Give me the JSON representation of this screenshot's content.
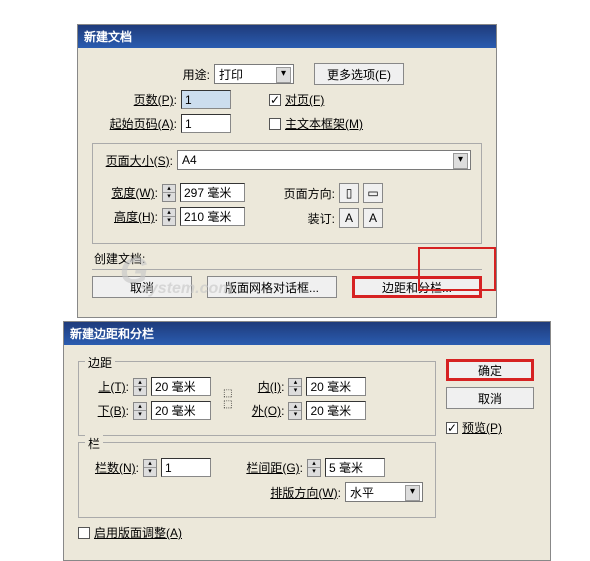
{
  "dialog1": {
    "title": "新建文档",
    "use_label": "用途:",
    "use_value": "打印",
    "more_options_btn": "更多选项(E)",
    "pages_label": "页数(P):",
    "pages_value": "1",
    "facing_label": "对页(F)",
    "start_page_label": "起始页码(A):",
    "start_page_value": "1",
    "master_frame_label": "主文本框架(M)",
    "page_size_label": "页面大小(S):",
    "page_size_value": "A4",
    "width_label": "宽度(W):",
    "width_value": "297 毫米",
    "height_label": "高度(H):",
    "height_value": "210 毫米",
    "orientation_label": "页面方向:",
    "binding_label": "装订:",
    "create_doc_label": "创建文档:",
    "cancel_btn": "取消",
    "grid_btn": "版面网格对话框...",
    "margin_btn": "边距和分栏..."
  },
  "dialog2": {
    "title": "新建边距和分栏",
    "margins_label": "边距",
    "top_label": "上(T):",
    "top_value": "20 毫米",
    "bottom_label": "下(B):",
    "bottom_value": "20 毫米",
    "inside_label": "内(I):",
    "inside_value": "20 毫米",
    "outside_label": "外(O):",
    "outside_value": "20 毫米",
    "columns_label": "栏",
    "col_count_label": "栏数(N):",
    "col_count_value": "1",
    "gutter_label": "栏间距(G):",
    "gutter_value": "5 毫米",
    "direction_label": "排版方向(W):",
    "direction_value": "水平",
    "enable_layout_label": "启用版面调整(A)",
    "ok_btn": "确定",
    "cancel_btn": "取消",
    "preview_label": "预览(P)"
  },
  "icons": {
    "up": "▴",
    "down": "▾",
    "check": "✓",
    "portrait": "▯",
    "landscape": "▭",
    "book_l": "A",
    "book_r": "A"
  },
  "watermark1": "system.com",
  "chart_data": null
}
